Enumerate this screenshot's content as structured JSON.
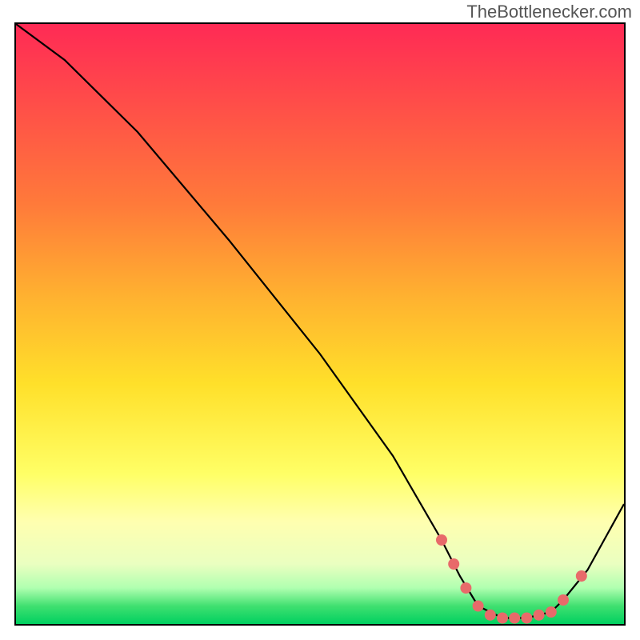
{
  "watermark": "TheBottlenecker.com",
  "chart_data": {
    "type": "line",
    "title": "",
    "xlabel": "",
    "ylabel": "",
    "xlim": [
      0,
      100
    ],
    "ylim": [
      0,
      100
    ],
    "grid": false,
    "legend": false,
    "series": [
      {
        "name": "curve",
        "color": "#000000",
        "x": [
          0,
          8,
          20,
          35,
          50,
          62,
          70,
          73,
          76,
          80,
          84,
          88,
          90,
          94,
          100
        ],
        "y": [
          100,
          94,
          82,
          64,
          45,
          28,
          14,
          8,
          3,
          1,
          1,
          2,
          4,
          9,
          20
        ]
      }
    ],
    "markers": {
      "color": "#e86a6a",
      "radius": 7,
      "x": [
        70,
        72,
        74,
        76,
        78,
        80,
        82,
        84,
        86,
        88,
        90,
        93
      ],
      "y": [
        14,
        10,
        6,
        3,
        1.5,
        1,
        1,
        1,
        1.5,
        2,
        4,
        8
      ]
    },
    "gradient_stops": [
      {
        "pos": 0,
        "color": "#ff2a55"
      },
      {
        "pos": 0.5,
        "color": "#ffe02a"
      },
      {
        "pos": 1,
        "color": "#00d060"
      }
    ]
  }
}
